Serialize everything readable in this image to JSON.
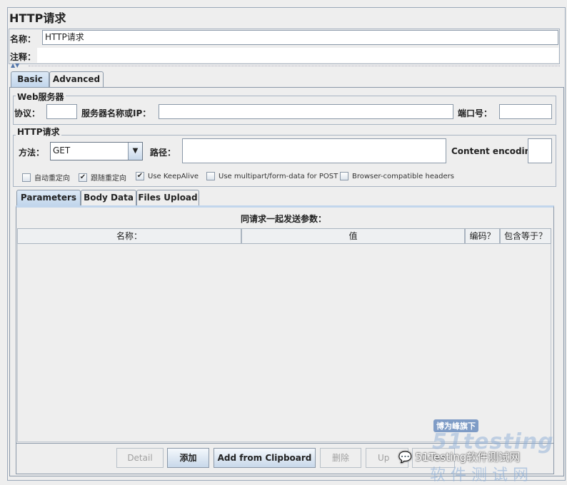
{
  "title": "HTTP请求",
  "name_label": "名称：",
  "name_value": "HTTP请求",
  "comment_label": "注释：",
  "comment_value": "",
  "tabs": [
    {
      "label": "Basic",
      "selected": true
    },
    {
      "label": "Advanced",
      "selected": false
    }
  ],
  "web_server": {
    "legend": "Web服务器",
    "protocol_label": "协议：",
    "protocol_value": "",
    "server_label": "服务器名称或IP：",
    "server_value": "",
    "port_label": "端口号：",
    "port_value": ""
  },
  "http_request": {
    "legend": "HTTP请求",
    "method_label": "方法：",
    "method_value": "GET",
    "path_label": "路径：",
    "path_value": "",
    "encoding_label": "Content encoding:",
    "encoding_value": ""
  },
  "checkboxes": [
    {
      "label": "自动重定向",
      "checked": false
    },
    {
      "label": "跟随重定向",
      "checked": true
    },
    {
      "label": "Use KeepAlive",
      "checked": true
    },
    {
      "label": "Use multipart/form-data for POST",
      "checked": false
    },
    {
      "label": "Browser-compatible headers",
      "checked": false
    }
  ],
  "subtabs": [
    {
      "label": "Parameters",
      "selected": true
    },
    {
      "label": "Body Data",
      "selected": false
    },
    {
      "label": "Files Upload",
      "selected": false
    }
  ],
  "params": {
    "title": "同请求一起发送参数：",
    "columns": [
      "名称：",
      "值",
      "编码？",
      "包含等于？"
    ],
    "rows": []
  },
  "buttons": [
    {
      "label": "Detail",
      "enabled": false
    },
    {
      "label": "添加",
      "enabled": true
    },
    {
      "label": "Add from Clipboard",
      "enabled": true
    },
    {
      "label": "删除",
      "enabled": false
    },
    {
      "label": "Up",
      "enabled": false
    },
    {
      "label": "Down",
      "enabled": false
    }
  ],
  "watermark": {
    "badge": "博为峰旗下",
    "logo": "51testing",
    "cn": "软 件 测 试 网",
    "wechat": "51Testing软件测试网"
  }
}
